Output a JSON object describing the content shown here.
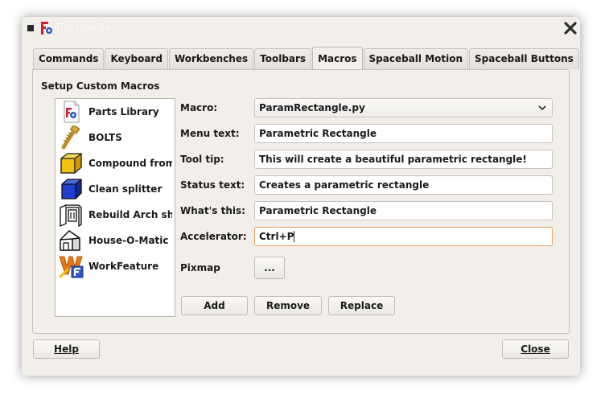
{
  "window": {
    "title": "Customize"
  },
  "tabs": [
    {
      "label": "Commands",
      "active": false
    },
    {
      "label": "Keyboard",
      "active": false
    },
    {
      "label": "Workbenches",
      "active": false
    },
    {
      "label": "Toolbars",
      "active": false
    },
    {
      "label": "Macros",
      "active": true
    },
    {
      "label": "Spaceball Motion",
      "active": false
    },
    {
      "label": "Spaceball Buttons",
      "active": false
    }
  ],
  "section": {
    "title": "Setup Custom Macros"
  },
  "macros": [
    {
      "label": "Parts Library",
      "icon": "parts-library-icon"
    },
    {
      "label": "BOLTS",
      "icon": "bolt-icon"
    },
    {
      "label": "Compound from ...",
      "icon": "yellow-cube-icon"
    },
    {
      "label": "Clean splitter",
      "icon": "blue-cube-icon"
    },
    {
      "label": "Rebuild Arch sha...",
      "icon": "arch-shapes-icon"
    },
    {
      "label": "House-O-Matic",
      "icon": "house-icon"
    },
    {
      "label": "WorkFeature",
      "icon": "workfeature-icon"
    }
  ],
  "form": {
    "macro_label": "Macro:",
    "macro_value": "ParamRectangle.py",
    "menu_text_label": "Menu text:",
    "menu_text_value": "Parametric Rectangle",
    "tool_tip_label": "Tool tip:",
    "tool_tip_value": "This will create a beautiful parametric rectangle!",
    "status_text_label": "Status text:",
    "status_text_value": "Creates a parametric rectangle",
    "whats_this_label": "What's this:",
    "whats_this_value": "Parametric Rectangle",
    "accelerator_label": "Accelerator:",
    "accelerator_value": "Ctrl+P",
    "pixmap_label": "Pixmap",
    "pixmap_button": "..."
  },
  "actions": {
    "add": "Add",
    "remove": "Remove",
    "replace": "Replace"
  },
  "footer": {
    "help": "Help",
    "close": "Close"
  },
  "colors": {
    "dialog_bg": "#f2efeb",
    "focus_border": "#e8a25a",
    "cube_blue": "#1f3fd1",
    "cube_yellow": "#f2c010"
  }
}
